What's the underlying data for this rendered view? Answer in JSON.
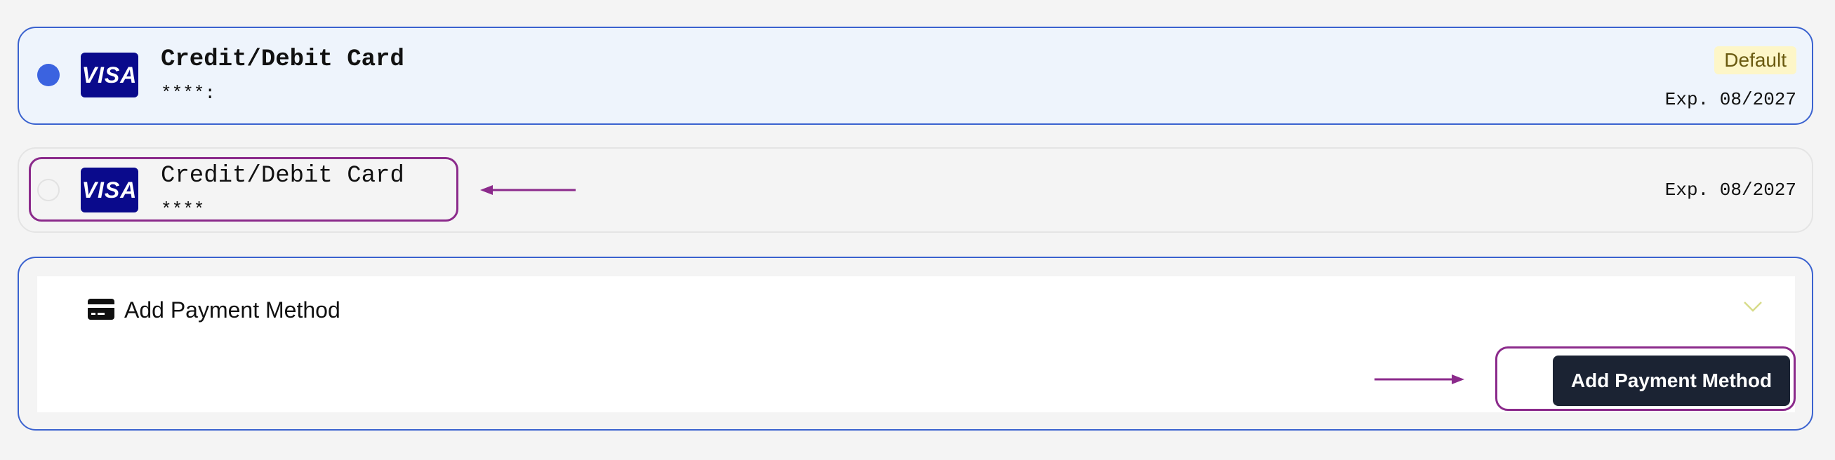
{
  "payment_methods": [
    {
      "title": "Credit/Debit Card",
      "masked_number": "****:",
      "brand": "VISA",
      "badge": "Default",
      "expiry": "Exp. 08/2027",
      "selected": true
    },
    {
      "title": "Credit/Debit Card",
      "masked_number": "****",
      "brand": "VISA",
      "expiry": "Exp. 08/2027",
      "selected": false
    }
  ],
  "add_panel": {
    "title": "Add Payment Method",
    "button_label": "Add Payment Method",
    "icons": [
      "credit-card-icon",
      "chevron-down-icon"
    ]
  },
  "colors": {
    "accent_blue": "#3a62cf",
    "radio_selected": "#3b63e0",
    "visa_blue": "#0a0a8c",
    "badge_bg": "#fdf6c8",
    "button_dark": "#1b2333",
    "annotation_purple": "#8b2a8b",
    "chevron_color": "#d7dc8a"
  }
}
